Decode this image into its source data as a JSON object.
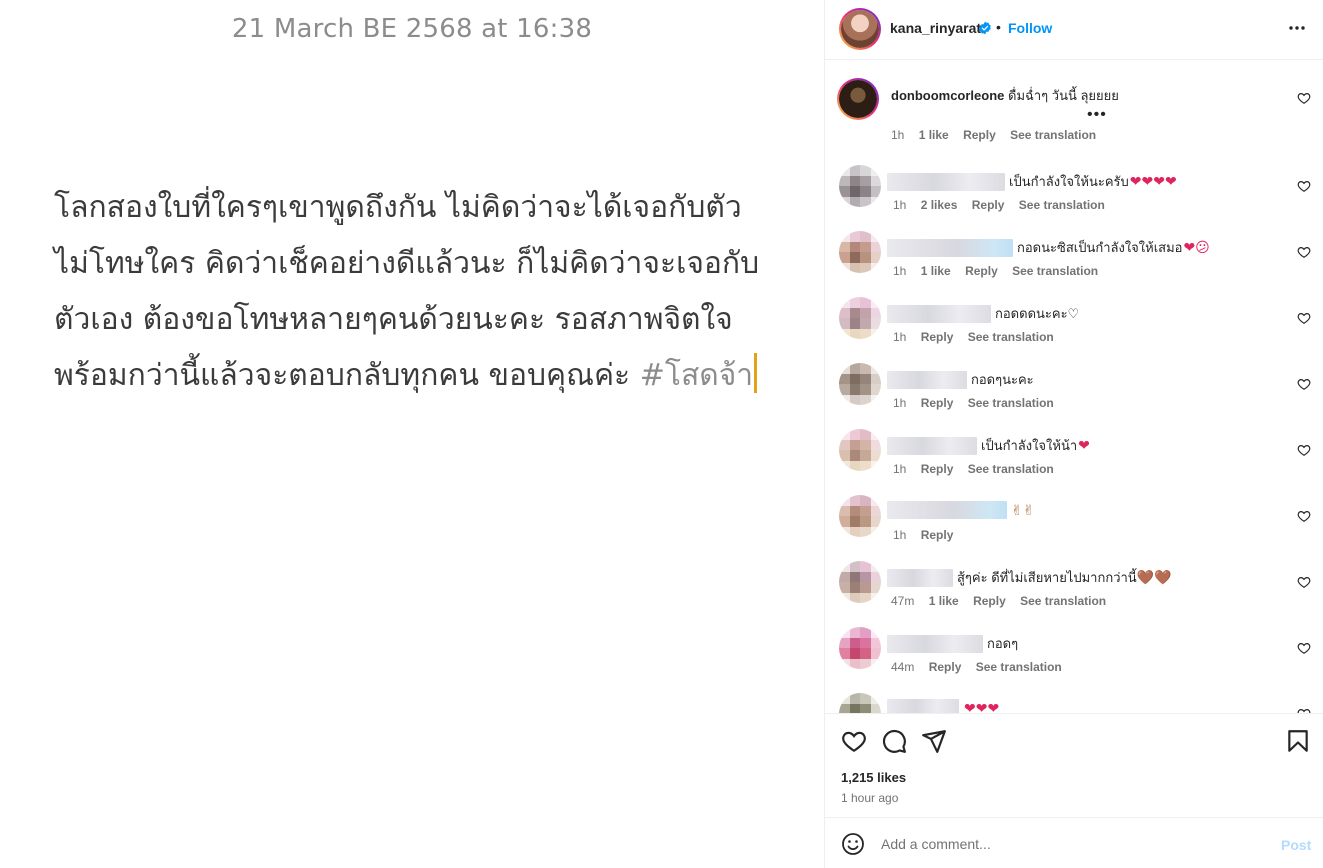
{
  "note": {
    "date": "21 March BE 2568 at 16:38",
    "lines": [
      "โลกสองใบที่ใครๆเขาพูดถึงกัน ไม่คิดว่าจะได้เจอกับตัว",
      "ไม่โทษใคร คิดว่าเช็คอย่างดีแล้วนะ ก็ไม่คิดว่าจะเจอกับ",
      "ตัวเอง ต้องขอโทษหลายๆคนด้วยนะคะ รอสภาพจิตใจ",
      "พร้อมกว่านี้แล้วจะตอบกลับทุกคน ขอบคุณค่ะ "
    ],
    "hashtag": "#โสดจ้า"
  },
  "header": {
    "username": "kana_rinyarat",
    "separator": "•",
    "follow_label": "Follow"
  },
  "main_comment": {
    "username": "donboomcorleone",
    "text": "ดื่มฉ่ำๆ วันนี้ ลุยยยย",
    "ellipsis": "•••",
    "time": "1h",
    "likes": "1 like",
    "reply": "Reply",
    "translate": "See translation"
  },
  "comments": [
    {
      "text": "เป็นกำลังใจให้นะครับ",
      "emoji": "❤❤❤❤",
      "time": "1h",
      "likes": "2 likes",
      "reply": "Reply",
      "translate": "See translation"
    },
    {
      "text": "กอดนะซิสเป็นกำลังใจให้เสมอ ",
      "emoji": "❤😕",
      "time": "1h",
      "likes": "1 like",
      "reply": "Reply",
      "translate": "See translation"
    },
    {
      "text": "กอดดดนะคะ♡",
      "emoji": "",
      "time": "1h",
      "likes": "",
      "reply": "Reply",
      "translate": "See translation"
    },
    {
      "text": "กอดๆนะคะ",
      "emoji": "",
      "time": "1h",
      "likes": "",
      "reply": "Reply",
      "translate": "See translation"
    },
    {
      "text": "เป็นกำลังใจให้น้า",
      "emoji": "❤",
      "time": "1h",
      "likes": "",
      "reply": "Reply",
      "translate": "See translation"
    },
    {
      "text": "",
      "emoji": "✌✌",
      "time": "1h",
      "likes": "",
      "reply": "Reply",
      "translate": ""
    },
    {
      "text": "สู้ๆค่ะ ดีที่ไม่เสียหายไปมากกว่านี้",
      "emoji": "🤎🤎",
      "time": "47m",
      "likes": "1 like",
      "reply": "Reply",
      "translate": "See translation"
    },
    {
      "text": "กอดๆ",
      "emoji": "",
      "time": "44m",
      "likes": "",
      "reply": "Reply",
      "translate": "See translation"
    },
    {
      "text": "",
      "emoji": "❤❤❤",
      "time": "",
      "likes": "",
      "reply": "",
      "translate": ""
    }
  ],
  "footer": {
    "likes_count": "1,215 likes",
    "posted_time": "1 hour ago",
    "comment_placeholder": "Add a comment...",
    "post_label": "Post"
  },
  "icons": {
    "verified": "verified-badge-icon",
    "more": "more-options-icon",
    "like": "heart-outline-icon",
    "comment": "comment-bubble-icon",
    "share": "paper-plane-icon",
    "save": "bookmark-icon",
    "emoji": "emoji-smiley-icon"
  },
  "colors": {
    "follow": "#0095f6",
    "meta": "#737373",
    "cursor": "#e3a316",
    "heart": "#e0245e",
    "post_disabled": "#b3dbff"
  }
}
